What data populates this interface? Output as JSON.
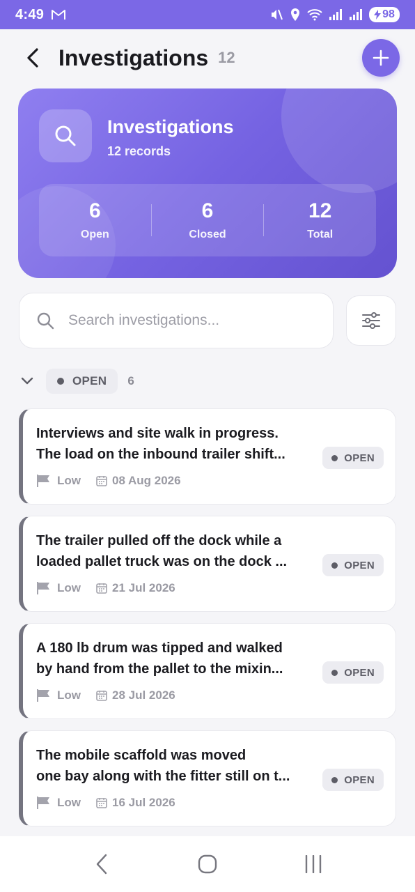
{
  "status_bar": {
    "time": "4:49",
    "battery": "98"
  },
  "header": {
    "title": "Investigations",
    "count": "12"
  },
  "summary": {
    "title": "Investigations",
    "subtitle": "12 records",
    "stats": [
      {
        "value": "6",
        "label": "Open"
      },
      {
        "value": "6",
        "label": "Closed"
      },
      {
        "value": "12",
        "label": "Total"
      }
    ]
  },
  "search": {
    "placeholder": "Search investigations..."
  },
  "section": {
    "label": "OPEN",
    "count": "6"
  },
  "items": [
    {
      "title_line1": "Interviews and site walk in progress.",
      "title_line2": "The load on the inbound trailer shift...",
      "priority": "Low",
      "date": "08 Aug 2026",
      "status": "OPEN"
    },
    {
      "title_line1": "The trailer pulled off the dock while a",
      "title_line2": "loaded pallet truck was on the dock ...",
      "priority": "Low",
      "date": "21 Jul 2026",
      "status": "OPEN"
    },
    {
      "title_line1": "A 180 lb drum was tipped and walked",
      "title_line2": "by hand from the pallet to the mixin...",
      "priority": "Low",
      "date": "28 Jul 2026",
      "status": "OPEN"
    },
    {
      "title_line1": "The mobile scaffold was moved",
      "title_line2": "one bay along with the fitter still on t...",
      "priority": "Low",
      "date": "16 Jul 2026",
      "status": "OPEN"
    }
  ],
  "colors": {
    "accent": "#7b68e6",
    "status_open": "#747480"
  },
  "icons": {
    "mail": "gmail-icon",
    "back": "chevron-left-icon",
    "add": "plus-icon",
    "search": "search-icon",
    "filter": "sliders-icon",
    "priority": "flag-icon",
    "date": "calendar-icon"
  }
}
